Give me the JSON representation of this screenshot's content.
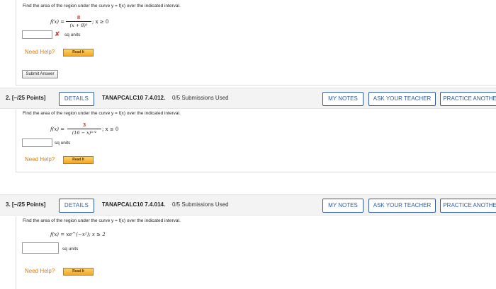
{
  "q1": {
    "prompt": "Find the area of the region under the curve y = f(x) over the indicated interval.",
    "f_lhs": "f(x) =",
    "numerator": "8",
    "denominator": "(x + 8)³",
    "condition": ";   x ≥ 0",
    "units": "sq units",
    "need_help": "Need Help?",
    "read_it": "Read It",
    "submit": "Submit Answer"
  },
  "q2": {
    "number": "2.  [–/25 Points]",
    "details": "DETAILS",
    "code": "TANAPCALC10 7.4.012.",
    "submissions": "0/5 Submissions Used",
    "my_notes": "MY NOTES",
    "ask_teacher": "ASK YOUR TEACHER",
    "practice": "PRACTICE ANOTHER",
    "prompt": "Find the area of the region under the curve y = f(x) over the indicated interval.",
    "f_lhs": "f(x) =",
    "numerator": "3",
    "denominator": "(16 − x)³ᐟ²",
    "condition": ";   x ≤ 0",
    "units": "sq units",
    "need_help": "Need Help?",
    "read_it": "Read It"
  },
  "q3": {
    "number": "3.  [–/25 Points]",
    "details": "DETAILS",
    "code": "TANAPCALC10 7.4.014.",
    "submissions": "0/5 Submissions Used",
    "my_notes": "MY NOTES",
    "ask_teacher": "ASK YOUR TEACHER",
    "practice": "PRACTICE ANOTHER",
    "prompt": "Find the area of the region under the curve y = f(x) over the indicated interval.",
    "function": "f(x) = xe^(−x²);   x ≥ 2",
    "units": "sq units",
    "need_help": "Need Help?",
    "read_it": "Read It"
  }
}
